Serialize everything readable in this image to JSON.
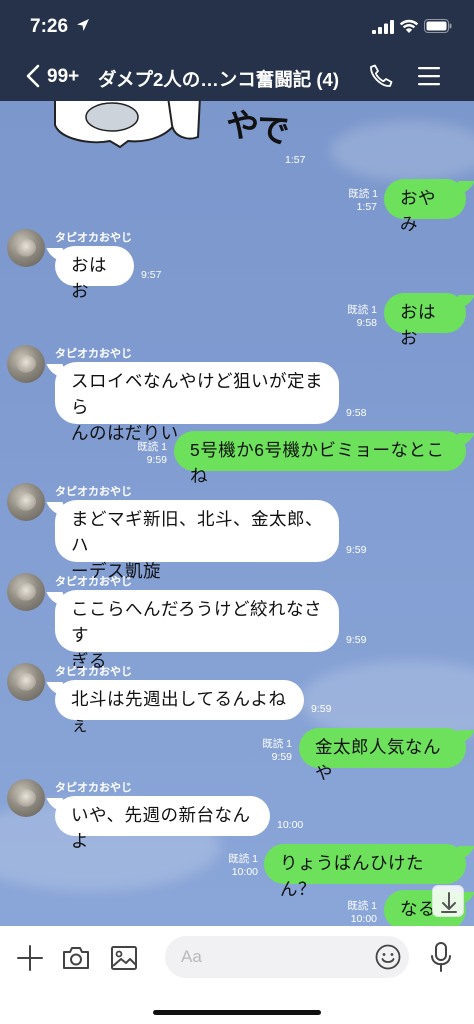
{
  "status_bar": {
    "time": "7:26"
  },
  "nav": {
    "back_count": "99+",
    "title": "ダメプ2人の…ンコ奮闘記 (4)"
  },
  "messages": [
    {
      "direction": "in",
      "sticker_text": "やで",
      "time": "1:57"
    },
    {
      "direction": "out",
      "text": "おやみ",
      "read": "既読 1",
      "time": "1:57"
    },
    {
      "direction": "in",
      "sender": "タピオカおやじ",
      "text": "おはお",
      "time": "9:57"
    },
    {
      "direction": "out",
      "text": "おはお",
      "read": "既読 1",
      "time": "9:58"
    },
    {
      "direction": "in",
      "sender": "タピオカおやじ",
      "text_lines": [
        "スロイベなんやけど狙いが定まら",
        "んのはだりい"
      ],
      "time": "9:58"
    },
    {
      "direction": "out",
      "text": "5号機か6号機かビミョーなとこね",
      "read": "既読 1",
      "time": "9:59"
    },
    {
      "direction": "in",
      "sender": "タピオカおやじ",
      "text_lines": [
        "まどマギ新旧、北斗、金太郎、ハ",
        "ーデス凱旋"
      ],
      "time": "9:59"
    },
    {
      "direction": "in",
      "sender": "タピオカおやじ",
      "text_lines": [
        "ここらへんだろうけど絞れなさす",
        "ぎる"
      ],
      "time": "9:59"
    },
    {
      "direction": "in",
      "sender": "タピオカおやじ",
      "text": "北斗は先週出してるんよねぇ",
      "time": "9:59"
    },
    {
      "direction": "out",
      "text": "金太郎人気なんや",
      "read": "既読 1",
      "time": "9:59"
    },
    {
      "direction": "in",
      "sender": "タピオカおやじ",
      "text": "いや、先週の新台なんよ",
      "time": "10:00"
    },
    {
      "direction": "out",
      "text": "りょうばんひけたん？",
      "read": "既読 1",
      "time": "10:00"
    },
    {
      "direction": "out",
      "text": "なるほ",
      "read": "既読 1",
      "time": "10:00"
    }
  ],
  "input": {
    "placeholder": "Aa"
  },
  "colors": {
    "header": "#25324a",
    "outgoing_bubble": "#6de15b",
    "incoming_bubble": "#ffffff",
    "chat_background": "#7f9bd0"
  }
}
